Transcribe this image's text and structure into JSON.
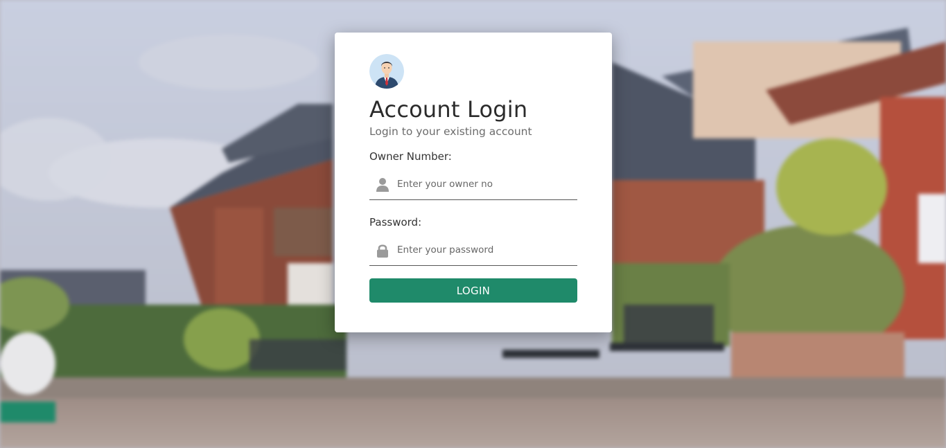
{
  "login": {
    "title": "Account Login",
    "subtitle": "Login to your existing account",
    "owner_label": "Owner Number:",
    "owner_placeholder": "Enter your owner no",
    "owner_value": "",
    "password_label": "Password:",
    "password_placeholder": "Enter your password",
    "password_value": "",
    "button_label": "LOGIN"
  },
  "icons": {
    "avatar": "businessman-avatar-icon",
    "owner": "user-icon",
    "password": "lock-icon"
  },
  "colors": {
    "button": "#1f8a6a",
    "card": "#ffffff",
    "title": "#2b2b2b",
    "subtitle": "#6c6c6c",
    "icon": "#9a9a9a"
  }
}
